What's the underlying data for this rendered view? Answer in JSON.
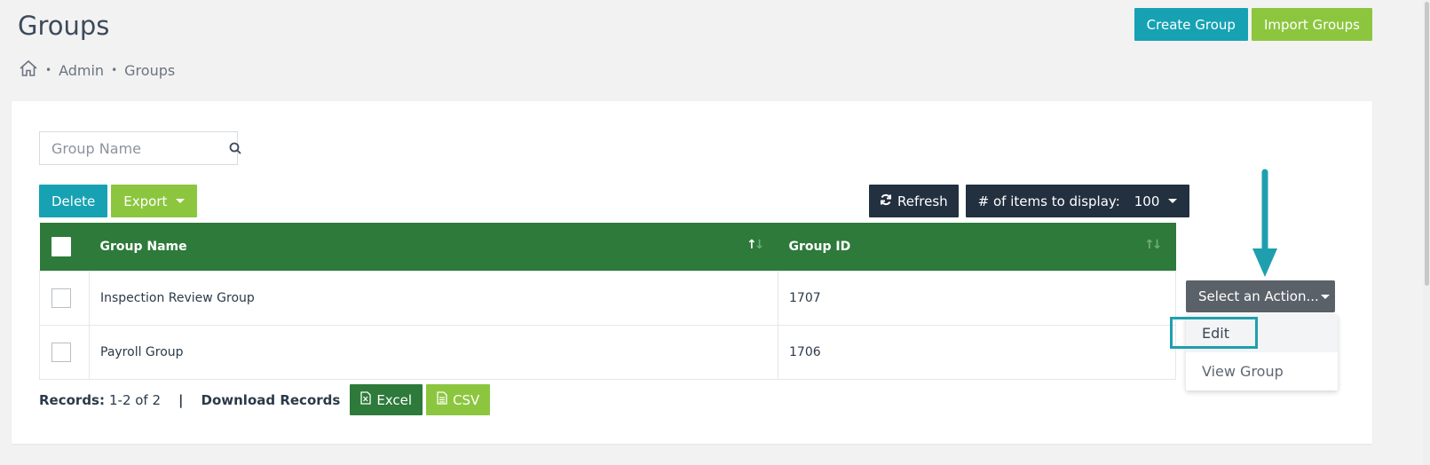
{
  "page": {
    "title": "Groups"
  },
  "breadcrumb": {
    "home_icon": "home-icon",
    "items": [
      "Admin",
      "Groups"
    ],
    "separator": "•"
  },
  "header_actions": {
    "create_label": "Create Group",
    "import_label": "Import Groups"
  },
  "search": {
    "placeholder": "Group Name",
    "value": "",
    "icon": "search-icon"
  },
  "toolbar": {
    "delete_label": "Delete",
    "export_label": "Export",
    "refresh_label": "Refresh",
    "refresh_icon": "refresh-icon",
    "items_label": "# of items to display:",
    "items_value": "100"
  },
  "table": {
    "columns": [
      "Group Name",
      "Group ID"
    ],
    "rows": [
      {
        "name": "Inspection Review Group",
        "id": "1707"
      },
      {
        "name": "Payroll Group",
        "id": "1706"
      }
    ]
  },
  "footer": {
    "records_label": "Records:",
    "records_value": "1-2 of 2",
    "pipe": "|",
    "download_label": "Download Records",
    "excel_label": "Excel",
    "csv_label": "CSV"
  },
  "action_menu": {
    "selected": "Select an Action...",
    "options": [
      "Edit",
      "View Group"
    ]
  },
  "colors": {
    "teal": "#16a2b3",
    "lime": "#8cc63f",
    "header_green": "#2d7a3a",
    "navy": "#223040",
    "action_gray": "#5b6169"
  }
}
